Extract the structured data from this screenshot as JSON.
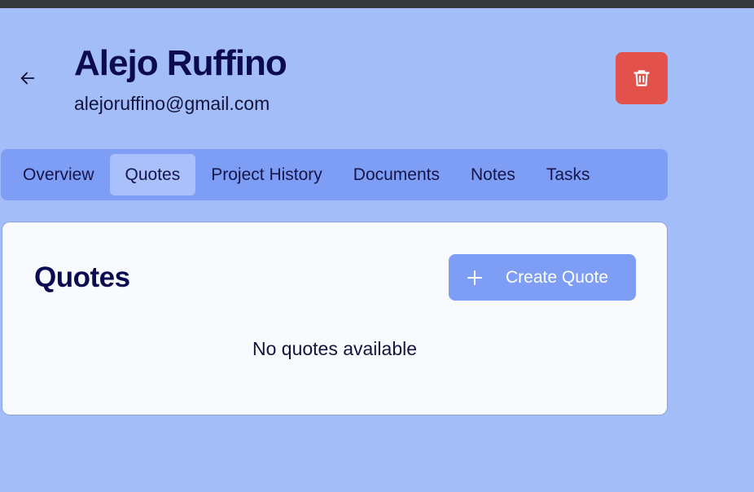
{
  "customer": {
    "name": "Alejo Ruffino",
    "email": "alejoruffino@gmail.com"
  },
  "header": {
    "back_icon": "arrow-left-icon",
    "delete_icon": "trash-icon",
    "delete_color": "#e2524a"
  },
  "tabs": [
    {
      "label": "Overview",
      "active": false
    },
    {
      "label": "Quotes",
      "active": true
    },
    {
      "label": "Project History",
      "active": false
    },
    {
      "label": "Documents",
      "active": false
    },
    {
      "label": "Notes",
      "active": false
    },
    {
      "label": "Tasks",
      "active": false
    }
  ],
  "quotes_panel": {
    "title": "Quotes",
    "create_label": "Create Quote",
    "create_icon": "plus-icon",
    "empty_message": "No quotes available"
  },
  "colors": {
    "page_background": "#a3bdf9",
    "accent": "#7e9ef5",
    "text_dark": "#0c0b52"
  }
}
